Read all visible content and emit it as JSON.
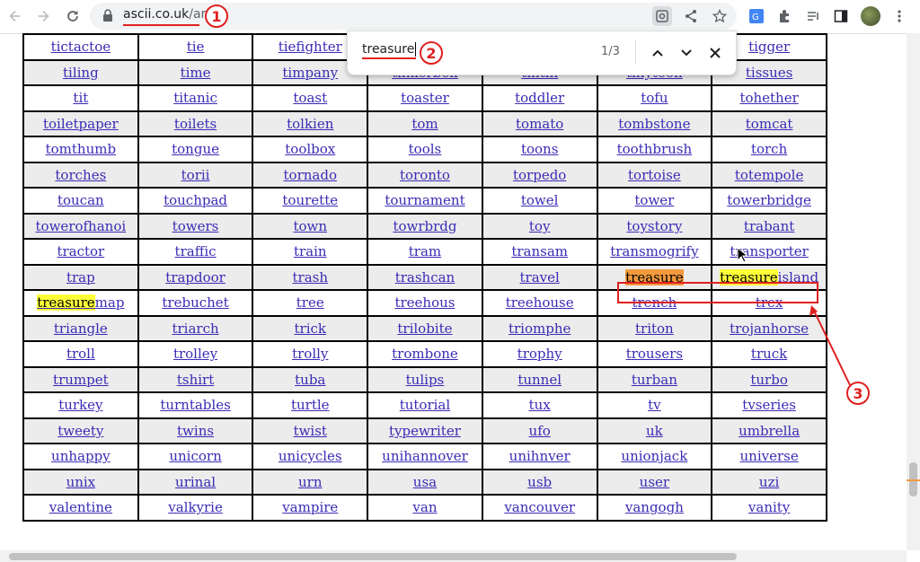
{
  "browser": {
    "url_domain": "ascii.co.uk",
    "url_path": "/art",
    "annotation_1": "1",
    "annotation_2": "2",
    "annotation_3": "3"
  },
  "find": {
    "query": "treasure",
    "count": "1/3"
  },
  "rows": [
    [
      "tictactoe",
      "tie",
      "tiefighter",
      "",
      "",
      "",
      "tigger"
    ],
    [
      "tiling",
      "time",
      "timpany",
      "tinkerbell",
      "tintin",
      "tinytoon",
      "tissues"
    ],
    [
      "tit",
      "titanic",
      "toast",
      "toaster",
      "toddler",
      "tofu",
      "tohether"
    ],
    [
      "toiletpaper",
      "toilets",
      "tolkien",
      "tom",
      "tomato",
      "tombstone",
      "tomcat"
    ],
    [
      "tomthumb",
      "tongue",
      "toolbox",
      "tools",
      "toons",
      "toothbrush",
      "torch"
    ],
    [
      "torches",
      "torii",
      "tornado",
      "toronto",
      "torpedo",
      "tortoise",
      "totempole"
    ],
    [
      "toucan",
      "touchpad",
      "tourette",
      "tournament",
      "towel",
      "tower",
      "towerbridge"
    ],
    [
      "towerofhanoi",
      "towers",
      "town",
      "towrbrdg",
      "toy",
      "toystory",
      "trabant"
    ],
    [
      "tractor",
      "traffic",
      "train",
      "tram",
      "transam",
      "transmogrify",
      "transporter"
    ],
    [
      "trap",
      "trapdoor",
      "trash",
      "trashcan",
      "travel",
      "treasure",
      "treasureisland"
    ],
    [
      "treasuremap",
      "trebuchet",
      "tree",
      "treehous",
      "treehouse",
      "trench",
      "trex"
    ],
    [
      "triangle",
      "triarch",
      "trick",
      "trilobite",
      "triomphe",
      "triton",
      "trojanhorse"
    ],
    [
      "troll",
      "trolley",
      "trolly",
      "trombone",
      "trophy",
      "trousers",
      "truck"
    ],
    [
      "trumpet",
      "tshirt",
      "tuba",
      "tulips",
      "tunnel",
      "turban",
      "turbo"
    ],
    [
      "turkey",
      "turntables",
      "turtle",
      "tutorial",
      "tux",
      "tv",
      "tvseries"
    ],
    [
      "tweety",
      "twins",
      "twist",
      "typewriter",
      "ufo",
      "uk",
      "umbrella"
    ],
    [
      "unhappy",
      "unicorn",
      "unicycles",
      "unihannover",
      "unihnver",
      "unionjack",
      "universe"
    ],
    [
      "unix",
      "urinal",
      "urn",
      "usa",
      "usb",
      "user",
      "uzi"
    ],
    [
      "valentine",
      "valkyrie",
      "vampire",
      "van",
      "vancouver",
      "vangogh",
      "vanity"
    ]
  ]
}
